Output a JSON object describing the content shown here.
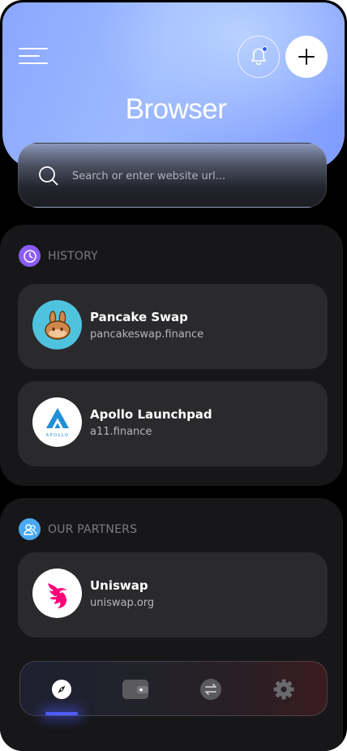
{
  "header": {
    "title": "Browser",
    "colors": {
      "gradient_start": "#8aa7ff",
      "gradient_end": "#7f9bff",
      "notification_dot": "#2f5bff"
    }
  },
  "icons": {
    "menu": "hamburger-menu-icon",
    "bell": "bell-icon",
    "plus": "plus-icon",
    "search": "search-icon"
  },
  "search": {
    "placeholder": "Search or enter website url..."
  },
  "history": {
    "label": "HISTORY",
    "icon": "clock-icon",
    "icon_color": "#8b5cf6",
    "items": [
      {
        "name": "Pancake Swap",
        "url": "pancakeswap.finance",
        "logo": "pancakeswap-logo"
      },
      {
        "name": "Apollo Launchpad",
        "url": "a11.finance",
        "logo": "apollo-logo",
        "logo_text": "APOLLO"
      }
    ]
  },
  "partners": {
    "label": "OUR PARTNERS",
    "icon": "users-icon",
    "icon_color": "#4aa8f0",
    "items": [
      {
        "name": "Uniswap",
        "url": "uniswap.org",
        "logo": "uniswap-logo"
      }
    ]
  },
  "tabbar": {
    "tabs": [
      {
        "icon": "compass-icon",
        "active": true
      },
      {
        "icon": "wallet-icon",
        "active": false
      },
      {
        "icon": "swap-arrows-icon",
        "active": false
      },
      {
        "icon": "settings-gear-icon",
        "active": false
      }
    ],
    "active_color": "#4e5cff"
  }
}
